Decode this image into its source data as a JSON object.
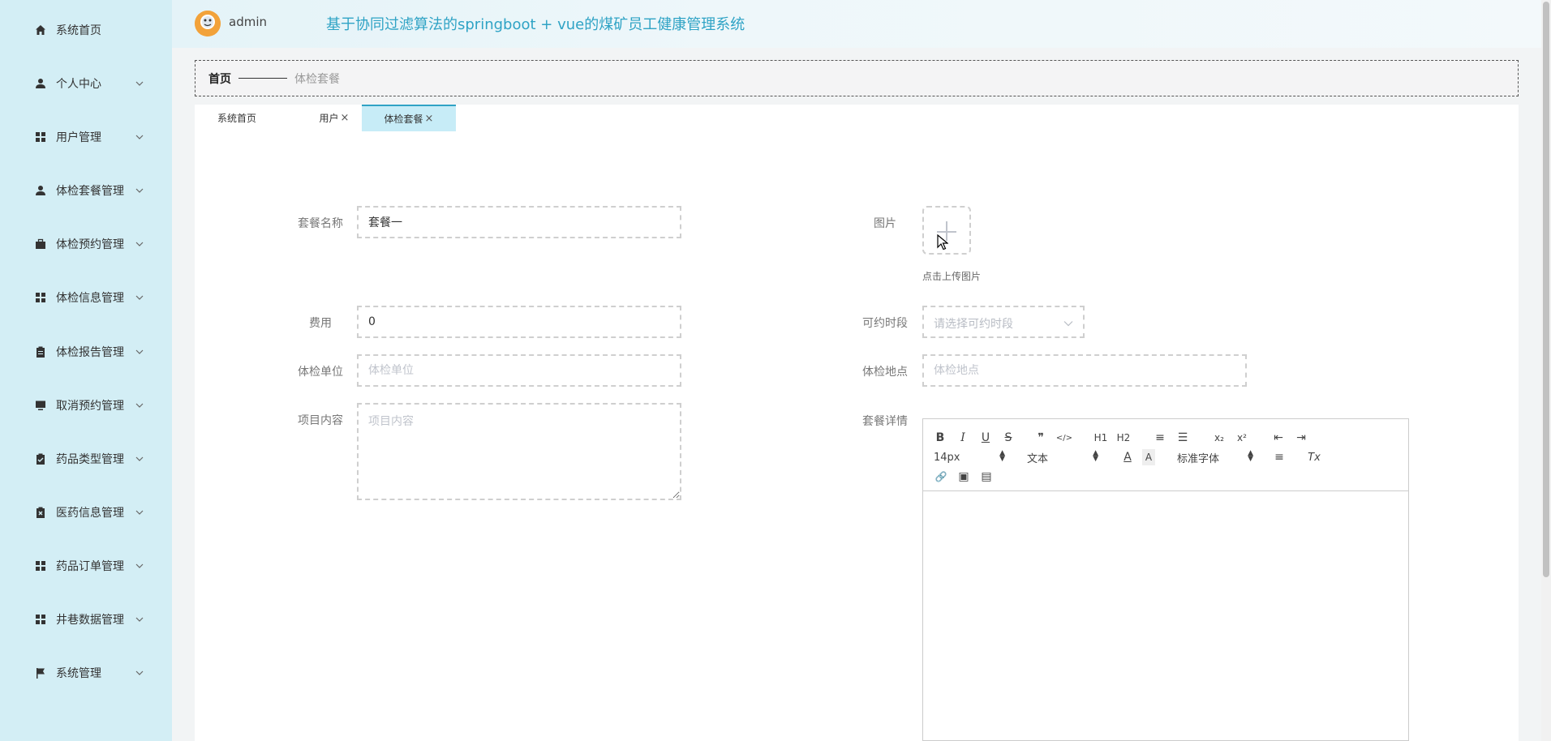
{
  "sidebar": {
    "items": [
      {
        "label": "系统首页",
        "icon": "home-icon",
        "has_arrow": false
      },
      {
        "label": "个人中心",
        "icon": "user-icon",
        "has_arrow": true
      },
      {
        "label": "用户管理",
        "icon": "grid-icon",
        "has_arrow": true
      },
      {
        "label": "体检套餐管理",
        "icon": "user-tie-icon",
        "has_arrow": true
      },
      {
        "label": "体检预约管理",
        "icon": "briefcase-icon",
        "has_arrow": true
      },
      {
        "label": "体检信息管理",
        "icon": "grid-icon",
        "has_arrow": true
      },
      {
        "label": "体检报告管理",
        "icon": "clipboard-icon",
        "has_arrow": true
      },
      {
        "label": "取消预约管理",
        "icon": "monitor-icon",
        "has_arrow": true
      },
      {
        "label": "药品类型管理",
        "icon": "clipboard-check-icon",
        "has_arrow": true
      },
      {
        "label": "医药信息管理",
        "icon": "clipboard-x-icon",
        "has_arrow": true
      },
      {
        "label": "药品订单管理",
        "icon": "grid-icon",
        "has_arrow": true
      },
      {
        "label": "井巷数据管理",
        "icon": "grid-icon",
        "has_arrow": true
      },
      {
        "label": "系统管理",
        "icon": "flag-icon",
        "has_arrow": true
      }
    ]
  },
  "header": {
    "user_name": "admin",
    "title": "基于协同过滤算法的springboot + vue的煤矿员工健康管理系统"
  },
  "breadcrumb": {
    "home": "首页",
    "current": "体检套餐"
  },
  "tabs": [
    {
      "label": "系统首页",
      "closable": false,
      "active": false
    },
    {
      "label": "用户",
      "closable": true,
      "active": false
    },
    {
      "label": "体检套餐",
      "closable": true,
      "active": true
    }
  ],
  "tab_close_glyph": "×",
  "form": {
    "package_name": {
      "label": "套餐名称",
      "value": "套餐一"
    },
    "image": {
      "label": "图片",
      "hint": "点击上传图片"
    },
    "fee": {
      "label": "费用",
      "value": "0"
    },
    "time_slot": {
      "label": "可约时段",
      "placeholder": "请选择可约时段"
    },
    "unit": {
      "label": "体检单位",
      "placeholder": "体检单位"
    },
    "location": {
      "label": "体检地点",
      "placeholder": "体检地点"
    },
    "items": {
      "label": "项目内容",
      "placeholder": "项目内容"
    },
    "details": {
      "label": "套餐详情"
    }
  },
  "editor": {
    "font_size": "14px",
    "header_select": "文本",
    "font_family": "标准字体",
    "buttons_row1": [
      {
        "name": "bold-icon",
        "glyph": "B"
      },
      {
        "name": "italic-icon",
        "glyph": "I"
      },
      {
        "name": "underline-icon",
        "glyph": "U"
      },
      {
        "name": "strikethrough-icon",
        "glyph": "S"
      },
      {
        "name": "blockquote-icon",
        "glyph": "❞"
      },
      {
        "name": "code-block-icon",
        "glyph": "</>"
      },
      {
        "name": "h1-icon",
        "glyph": "H1"
      },
      {
        "name": "h2-icon",
        "glyph": "H2"
      },
      {
        "name": "ordered-list-icon",
        "glyph": "≡"
      },
      {
        "name": "bullet-list-icon",
        "glyph": "☰"
      },
      {
        "name": "subscript-icon",
        "glyph": "x₂"
      },
      {
        "name": "superscript-icon",
        "glyph": "x²"
      },
      {
        "name": "outdent-icon",
        "glyph": "⇤"
      },
      {
        "name": "indent-icon",
        "glyph": "⇥"
      }
    ],
    "buttons_row2": [
      {
        "name": "font-color-icon",
        "glyph": "A"
      },
      {
        "name": "background-color-icon",
        "glyph": "A"
      },
      {
        "name": "align-icon",
        "glyph": "≡"
      },
      {
        "name": "clear-format-icon",
        "glyph": "Tx"
      }
    ],
    "buttons_row3": [
      {
        "name": "link-icon",
        "glyph": "🔗"
      },
      {
        "name": "image-icon",
        "glyph": "▣"
      },
      {
        "name": "video-icon",
        "glyph": "▤"
      }
    ]
  },
  "colors": {
    "sidebar_bg": "#d3eef5",
    "accent": "#2fa3c5",
    "active_tab_bg": "#c7ecf7"
  }
}
